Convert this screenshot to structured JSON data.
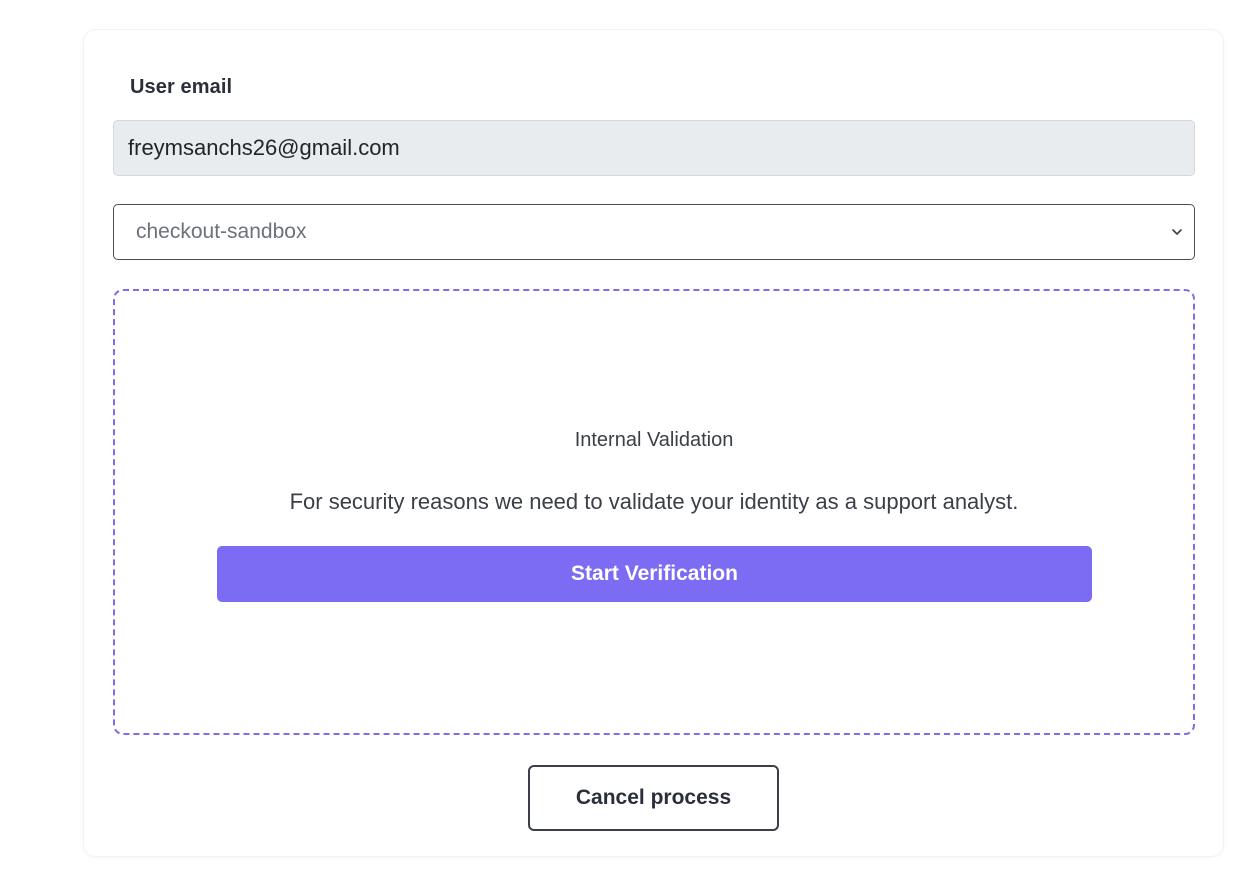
{
  "form": {
    "email_label": "User email",
    "email_value": "freymsanchs26@gmail.com",
    "environment_selected": "checkout-sandbox"
  },
  "validation": {
    "title": "Internal Validation",
    "description": "For security reasons we need to validate your identity as a support analyst.",
    "start_button_label": "Start Verification"
  },
  "actions": {
    "cancel_label": "Cancel process"
  },
  "colors": {
    "accent": "#7b6cf3",
    "dashed_border": "#7b6cf0",
    "readonly_input_bg": "#e9ecef"
  },
  "icons": {
    "select_indicator": "chevron-down-icon"
  }
}
